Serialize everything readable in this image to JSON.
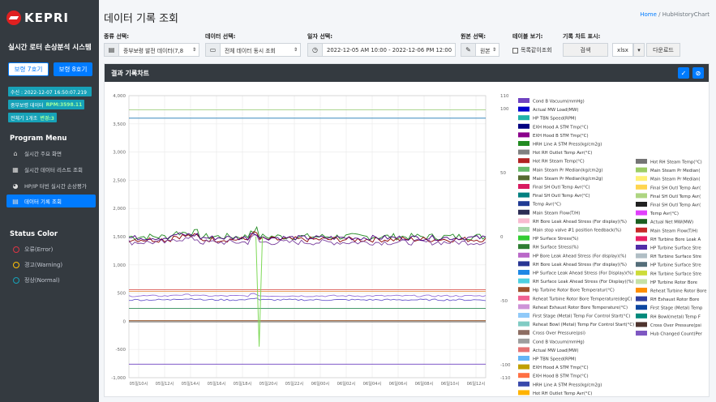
{
  "app": {
    "logo": "KEPRI",
    "system_title": "실시간 로터 손상분석 시스템"
  },
  "sidebar": {
    "unit_buttons": [
      "보령 7호기",
      "보령 8호기"
    ],
    "info": [
      {
        "label": "수신 : 2022-12-07 16:50:07.219",
        "highlight": ""
      },
      {
        "label": "중부보령 데이터",
        "highlight": "RPM:3598.11"
      },
      {
        "label": "전체기 1개조",
        "highlight": "변경:3"
      }
    ],
    "menu_title": "Program Menu",
    "menu": [
      "실시간 주요 화면",
      "실시간 데이터 리스트 조회",
      "HP/IP 터빈 실시간 손상평가",
      "데이터 기록 조회"
    ],
    "status_title": "Status Color",
    "status": [
      {
        "label": "오류(Error)",
        "color": "#dc3545"
      },
      {
        "label": "경고(Warning)",
        "color": "#ffc107"
      },
      {
        "label": "정상(Normal)",
        "color": "#17a2b8"
      }
    ]
  },
  "header": {
    "title": "데이터 기록 조회",
    "breadcrumb_home": "Home",
    "breadcrumb_sep": " / ",
    "breadcrumb_page": "HubHistoryChart"
  },
  "filters": {
    "type_label": "종류 선택:",
    "type_value": "중부보령 발전 데이터(7,8",
    "data_label": "데이터 선택:",
    "data_value": "전체 데이터 동시 조회",
    "date_label": "일자 선택:",
    "date_value": "2022-12-05 AM 10:00 - 2022-12-06 PM 12:00",
    "raw_label": "원본 선택:",
    "raw_value": "원본",
    "table_label": "테이블 보기:",
    "table_check": "목록같이조회",
    "chartview_label": "기록 차트 표시:",
    "search_btn": "검색",
    "format_value": "xlsx",
    "download_btn": "다운로드"
  },
  "card": {
    "title": "결과 기록차트"
  },
  "chart_data": {
    "type": "line",
    "y_left": {
      "ticks": [
        "4,000",
        "3,500",
        "3,000",
        "2,500",
        "2,000",
        "1,500",
        "1,000",
        "500",
        "0",
        "-500",
        "-1,000"
      ],
      "min": -1000,
      "max": 4000
    },
    "y_right": {
      "ticks": [
        "110",
        "100",
        "50",
        "0",
        "-50",
        "-100",
        "-110"
      ],
      "min": -110,
      "max": 110
    },
    "x_ticks": [
      "05일10시",
      "05일12시",
      "05일14시",
      "05일16시",
      "05일18시",
      "05일20시",
      "05일22시",
      "06일00시",
      "06일02시",
      "06일04시",
      "06일06시",
      "06일08시",
      "06일10시",
      "06일12시"
    ],
    "grid": true,
    "series": [
      {
        "y": 3750,
        "color": "#a0d080"
      },
      {
        "y": 3600,
        "color": "#1f78b4"
      },
      {
        "y": 1500,
        "color": "#228b22",
        "noise": 60
      },
      {
        "y": 1450,
        "color": "#8b0000",
        "noise": 50
      },
      {
        "y": 1400,
        "color": "#7b3f9e",
        "noise": 50
      },
      {
        "y": 1480,
        "color": "#4b0082",
        "noise": 45
      },
      {
        "y": 560,
        "color": "#d9534f"
      },
      {
        "y": 530,
        "color": "#e8a060"
      },
      {
        "y": 450,
        "color": "#9370db",
        "noise": 15
      },
      {
        "y": 380,
        "color": "#6a5acd",
        "noise": 15
      },
      {
        "y": 230,
        "color": "#2e8b57"
      },
      {
        "y": 10,
        "color": "#8b4513"
      },
      {
        "y": -10,
        "color": "#555555"
      },
      {
        "y": -760,
        "color": "#6f42c1"
      }
    ],
    "legend_col1": [
      {
        "name": "Cond B Vacuum(mmHg)",
        "color": "#6f42c1"
      },
      {
        "name": "Actual MW Load(MW)",
        "color": "#0000cd"
      },
      {
        "name": "HP TBN Speed(RPM)",
        "color": "#20b2aa"
      },
      {
        "name": "EXH Hood A STM Tmp(°C)",
        "color": "#000080"
      },
      {
        "name": "EXH Hood B STM Tmp(°C)",
        "color": "#8b008b"
      },
      {
        "name": "HRH Line A STM Press(kg/cm2g)",
        "color": "#228b22"
      },
      {
        "name": "Hot RH Outlet Temp Avr(°C)",
        "color": "#808080"
      },
      {
        "name": "Hot RH Steam Temp(°C)",
        "color": "#b22222"
      },
      {
        "name": "Main Steam Pr Median(kg/cm2g)",
        "color": "#66bb6a"
      },
      {
        "name": "Main Steam Pr Median(kg/cm2g)",
        "color": "#556b2f"
      },
      {
        "name": "Final SH Outl Temp Avr(°C)",
        "color": "#d81b60"
      },
      {
        "name": "Final SH Outl Temp Avr(°C)",
        "color": "#008080"
      },
      {
        "name": "Temp Avr(°C)",
        "color": "#1f3a93"
      },
      {
        "name": "Main Steam Flow(T/H)",
        "color": "#2c2c54"
      },
      {
        "name": "RH Bore Leak Ahead Stress (For display)(%)",
        "color": "#f8bbd0"
      },
      {
        "name": "Main stop valve #1 position feedback(%)",
        "color": "#a5d6a7"
      },
      {
        "name": "HP Surface Stress(%)",
        "color": "#32cd32"
      },
      {
        "name": "RH Surface Stress(%)",
        "color": "#2e7d32"
      },
      {
        "name": "HP Bore Leak Ahead Stress (For display)(%)",
        "color": "#ba68c8"
      },
      {
        "name": "RH Bore Leak Ahead Stress (For display)(%)",
        "color": "#283593"
      },
      {
        "name": "HP Surface Leak Ahead Stress (For Display)(%)",
        "color": "#1e88e5"
      },
      {
        "name": "RH Surface Leak Ahead Stress (For Display)(%)",
        "color": "#4dd0e1"
      },
      {
        "name": "Hp Turbine Rotor Bore Temperatur(°C)",
        "color": "#a0522d"
      },
      {
        "name": "Reheat Turbine Rotor Bore Temperature(degC)",
        "color": "#f06292"
      },
      {
        "name": "Reheat Exhaust Rotor Bore Temperature(°C)",
        "color": "#ce93d8"
      },
      {
        "name": "First Stage (Metal) Temp For Control Start(°C)",
        "color": "#90caf9"
      },
      {
        "name": "Reheat Bowl (Metal) Temp For Control Start(°C)",
        "color": "#80cbc4"
      },
      {
        "name": "Cross Over Pressure(psi)",
        "color": "#8d6e63"
      },
      {
        "name": "Cond B Vacuum(mmHg)",
        "color": "#9e9e9e"
      },
      {
        "name": "Actual MW Load(MW)",
        "color": "#e57373"
      },
      {
        "name": "HP TBN Speed(RPM)",
        "color": "#64b5f6"
      },
      {
        "name": "EXH Hood A STM Tmp(°C)",
        "color": "#c0a000"
      },
      {
        "name": "EXH Hood B STM Tmp(°C)",
        "color": "#ff7043"
      },
      {
        "name": "HRH Line A STM Press(kg/cm2g)",
        "color": "#3949ab"
      },
      {
        "name": "Hot RH Outlet Temp Avr(°C)",
        "color": "#ffb300"
      }
    ],
    "legend_col2": [
      {
        "name": "Hot RH Steam Temp(°C)",
        "color": "#757575"
      },
      {
        "name": "Main Steam Pr Median(",
        "color": "#9ccc65"
      },
      {
        "name": "Main Steam Pr Median(",
        "color": "#fff176"
      },
      {
        "name": "Final SH Outl Temp Avr(",
        "color": "#ffd54f"
      },
      {
        "name": "Final SH Outl Temp Avr(",
        "color": "#aed581"
      },
      {
        "name": "Final SH Outl Temp Avr(",
        "color": "#212121"
      },
      {
        "name": "Temp Avr(°C)",
        "color": "#e040fb"
      },
      {
        "name": "Actual Net MW(MW)",
        "color": "#1b5e20"
      },
      {
        "name": "Main Steam Flow(T/H)",
        "color": "#c62828"
      },
      {
        "name": "RH Turbine Bore Leak A",
        "color": "#e91e63"
      },
      {
        "name": "HP Turbine Surface Stre",
        "color": "#512da8"
      },
      {
        "name": "RH Turbine Surface Stre",
        "color": "#b0bec5"
      },
      {
        "name": "HP Turbine Surface Stre",
        "color": "#546e7a"
      },
      {
        "name": "RH Turbine Surface Stre",
        "color": "#cddc39"
      },
      {
        "name": "HP Turbine Rotor Bore",
        "color": "#c5e1a5"
      },
      {
        "name": "Reheat Turbine Rotor Bore",
        "color": "#ff8f00"
      },
      {
        "name": "RH Exhaust Rotor Bore",
        "color": "#303f9f"
      },
      {
        "name": "First Stage (Metal) Temp",
        "color": "#0d47a1"
      },
      {
        "name": "RH Bowl(metal) Temp F",
        "color": "#00897b"
      },
      {
        "name": "Cross Over Pressure(psi",
        "color": "#4e342e"
      },
      {
        "name": "Hub Changed Count(Per",
        "color": "#7e57c2"
      }
    ]
  }
}
